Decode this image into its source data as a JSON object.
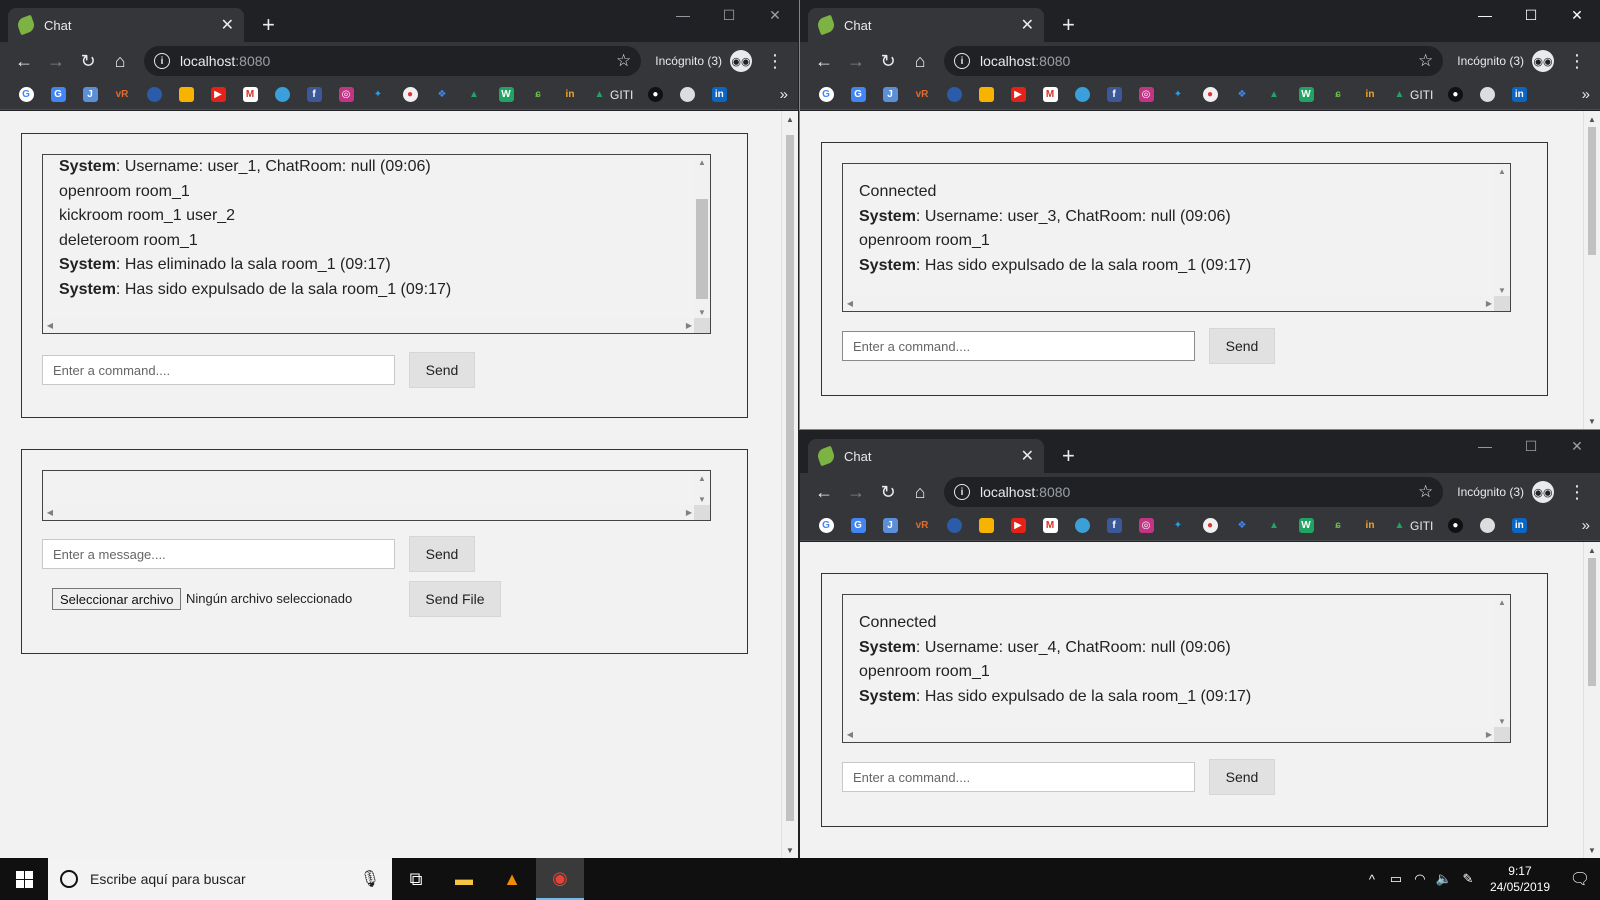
{
  "windows": {
    "left": {
      "tab_title": "Chat",
      "url_host": "localhost",
      "url_port": ":8080",
      "incognito_label": "Incógnito (3)",
      "command_log": [
        {
          "bold": "System",
          "text": ": Username: user_1, ChatRoom: null (09:06)"
        },
        {
          "bold": "",
          "text": "openroom room_1"
        },
        {
          "bold": "",
          "text": "kickroom room_1 user_2"
        },
        {
          "bold": "",
          "text": "deleteroom room_1"
        },
        {
          "bold": "System",
          "text": ": Has eliminado la sala room_1 (09:17)"
        },
        {
          "bold": "System",
          "text": ": Has sido expulsado de la sala room_1 (09:17)"
        }
      ],
      "command_placeholder": "Enter a command....",
      "command_send": "Send",
      "message_placeholder": "Enter a message....",
      "message_send": "Send",
      "file_button": "Seleccionar archivo",
      "file_status": "Ningún archivo seleccionado",
      "send_file": "Send File"
    },
    "right": {
      "tab_title": "Chat",
      "url_host": "localhost",
      "url_port": ":8080",
      "incognito_label": "Incógnito (3)",
      "command_log": [
        {
          "bold": "",
          "text": "Connected"
        },
        {
          "bold": "System",
          "text": ": Username: user_3, ChatRoom: null (09:06)"
        },
        {
          "bold": "",
          "text": "openroom room_1"
        },
        {
          "bold": "System",
          "text": ": Has sido expulsado de la sala room_1 (09:17)"
        }
      ],
      "command_placeholder": "Enter a command....",
      "command_send": "Send"
    },
    "bottom": {
      "tab_title": "Chat",
      "url_host": "localhost",
      "url_port": ":8080",
      "incognito_label": "Incógnito (3)",
      "command_log": [
        {
          "bold": "",
          "text": "Connected"
        },
        {
          "bold": "System",
          "text": ": Username: user_4, ChatRoom: null (09:06)"
        },
        {
          "bold": "",
          "text": "openroom room_1"
        },
        {
          "bold": "System",
          "text": ": Has sido expulsado de la sala room_1 (09:17)"
        }
      ],
      "command_placeholder": "Enter a command....",
      "command_send": "Send"
    }
  },
  "bookmarks": {
    "giti_label": "GITI",
    "icons": [
      "google-icon",
      "translate-icon",
      "jira-icon",
      "vr-icon",
      "shield-icon",
      "keep-icon",
      "youtube-icon",
      "gmail-icon",
      "bird-icon",
      "facebook-icon",
      "instagram-icon",
      "twitter-icon",
      "bulb-icon",
      "dropbox-icon",
      "drive-icon",
      "w-icon",
      "leaf-icon",
      "in-green-icon"
    ],
    "icons_after": [
      "github-icon",
      "dog-icon",
      "linkedin-icon"
    ]
  },
  "taskbar": {
    "search_placeholder": "Escribe aquí para buscar",
    "time": "9:17",
    "date": "24/05/2019"
  },
  "colors": {
    "chrome_dark": "#202124",
    "chrome_toolbar": "#35363a",
    "active_border": "#2aa8b8",
    "page_bg": "#f2f2f2",
    "button_bg": "#e1e1e1"
  }
}
